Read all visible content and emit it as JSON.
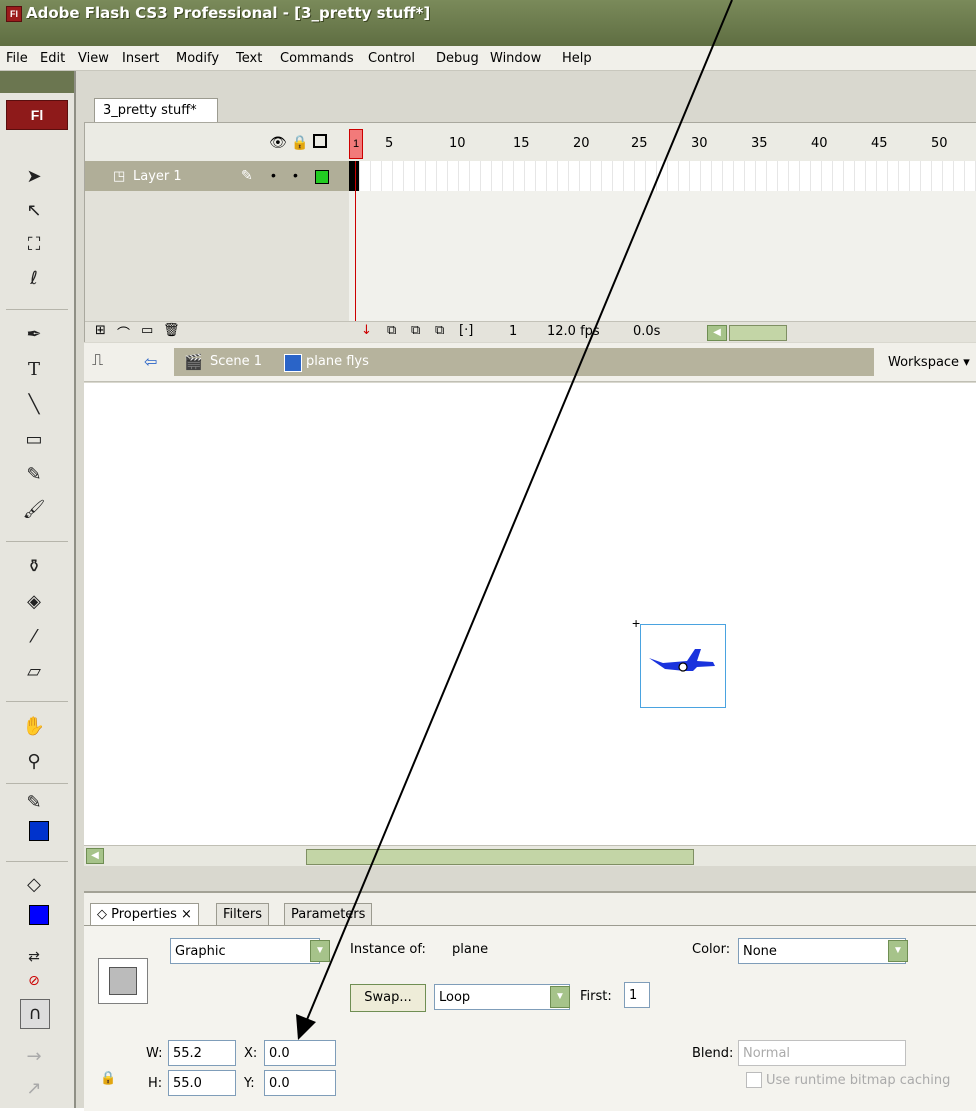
{
  "window": {
    "title": "Adobe Flash CS3 Professional - [3_pretty stuff*]",
    "logo": "Fl"
  },
  "menu": [
    "File",
    "Edit",
    "View",
    "Insert",
    "Modify",
    "Text",
    "Commands",
    "Control",
    "Debug",
    "Window",
    "Help"
  ],
  "tools": {
    "badge": "Fl"
  },
  "document": {
    "tab": "3_pretty stuff*"
  },
  "timeline": {
    "frame_numbers": [
      "1",
      "5",
      "10",
      "15",
      "20",
      "25",
      "30",
      "35",
      "40",
      "45",
      "50"
    ],
    "layer_name": "Layer 1",
    "current_frame": "1",
    "fps": "12.0 fps",
    "time": "0.0s"
  },
  "scene": {
    "scene_name": "Scene 1",
    "symbol_name": "plane flys",
    "workspace": "Workspace ▾"
  },
  "properties": {
    "tabs": [
      "Properties",
      "Filters",
      "Parameters"
    ],
    "symbol_type": "Graphic",
    "instance_label": "Instance of:",
    "instance_name": "plane",
    "swap_label": "Swap...",
    "loop_value": "Loop",
    "first_label": "First:",
    "first_value": "1",
    "color_label": "Color:",
    "color_value": "None",
    "w_label": "W:",
    "w_value": "55.2",
    "h_label": "H:",
    "h_value": "55.0",
    "x_label": "X:",
    "x_value": "0.0",
    "y_label": "Y:",
    "y_value": "0.0",
    "blend_label": "Blend:",
    "blend_value": "Normal",
    "cache_label": "Use runtime bitmap caching"
  },
  "colors": {
    "stroke_swatch": "#0033cc",
    "fill_swatch": "#0000ff",
    "accent": "#a6c38a"
  }
}
